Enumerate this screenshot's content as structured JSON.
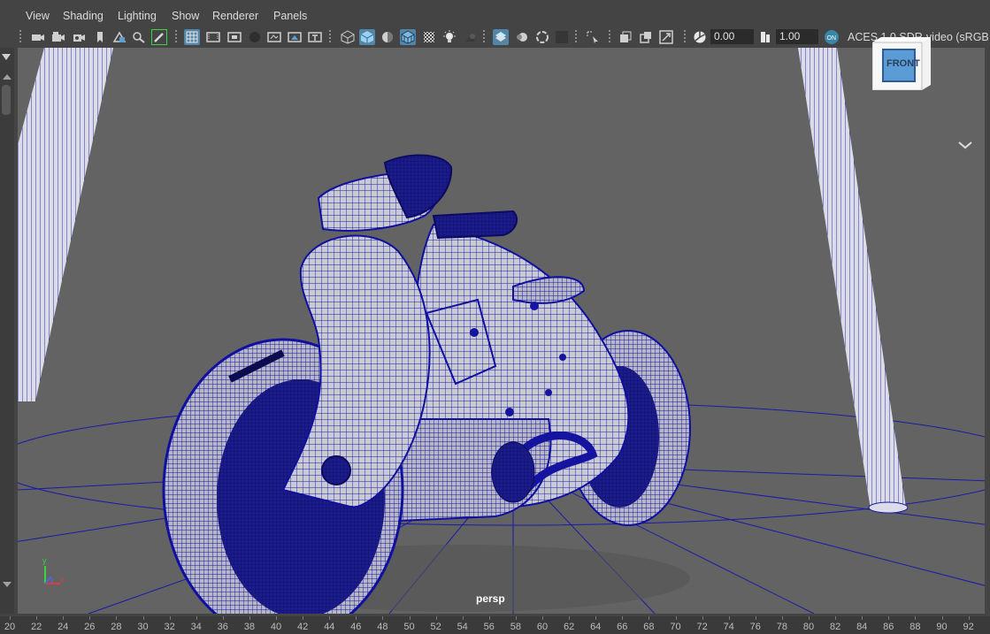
{
  "menu": [
    "View",
    "Shading",
    "Lighting",
    "Show",
    "Renderer",
    "Panels"
  ],
  "toolbar": {
    "icons": [
      "select-camera-icon",
      "camera-attributes-icon",
      "bookmark-icon",
      "image-plane-icon",
      "2d-pan-zoom-icon",
      "grease-pencil-icon",
      "grid-icon",
      "film-gate-icon",
      "resolution-gate-icon",
      "gate-mask-icon",
      "field-chart-icon",
      "safe-action-icon",
      "safe-title-icon",
      "wireframe-icon",
      "smooth-shade-all-icon",
      "use-default-material-icon",
      "wireframe-on-shaded-icon",
      "xray-icon",
      "use-all-lights-icon",
      "shadows-icon",
      "screen-space-ao-icon",
      "motion-blur-icon",
      "multisample-aa-icon",
      "depth-of-field-icon",
      "isolate-select-icon",
      "xray-joints-icon",
      "xray-active-components-icon",
      "backface-culling-icon",
      "exposure-icon",
      "gamma-icon",
      "color-management-icon"
    ],
    "exposure_value": "0.00",
    "gamma_value": "1.00",
    "colorspace": "ACES 1.0 SDR-video (sRGB"
  },
  "viewport": {
    "camera": "persp",
    "viewcube_face": "FRONT",
    "axis_labels": [
      "y",
      "z",
      "x"
    ],
    "background": "#636363",
    "wire_color": "#1a1aa6"
  },
  "timeline": {
    "ticks": [
      "20",
      "22",
      "24",
      "26",
      "28",
      "30",
      "32",
      "34",
      "36",
      "38",
      "40",
      "42",
      "44",
      "46",
      "48",
      "50",
      "52",
      "54",
      "56",
      "58",
      "60",
      "62",
      "64",
      "66",
      "68",
      "70",
      "72",
      "74",
      "76",
      "78",
      "80",
      "82",
      "84",
      "86",
      "88",
      "90",
      "92"
    ]
  }
}
